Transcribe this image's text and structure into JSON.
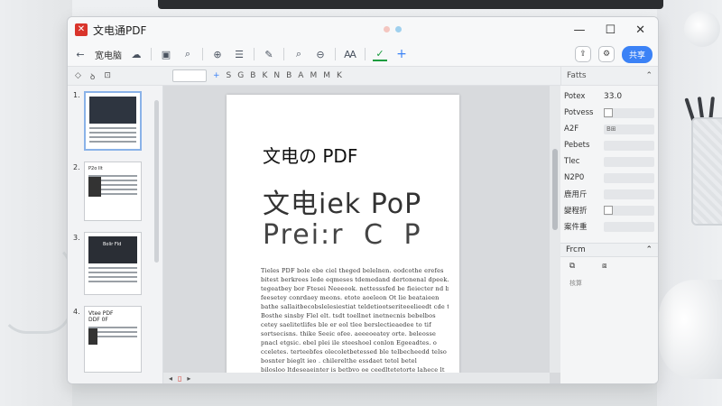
{
  "app": {
    "title": "文电通PDF",
    "logo_glyph": "✕"
  },
  "window_controls": {
    "minimize": "—",
    "maximize": "☐",
    "close": "✕"
  },
  "toolbar": {
    "back_label": "←",
    "view_label": "宽电脑",
    "right_button_label": "共享",
    "icons": [
      "save-icon",
      "search-icon",
      "zoom-in-icon",
      "list-icon",
      "edit-icon",
      "find-icon",
      "zoom-icon",
      "text-icon",
      "highlight-icon",
      "add-icon"
    ]
  },
  "subbar": {
    "thumb_tool_1": "◇",
    "thumb_tool_2": "ꝺ",
    "thumb_tool_3": "⊡",
    "font_select": "",
    "formats": [
      "+",
      "S",
      "G",
      "B",
      "K",
      "N",
      "B",
      "A",
      "M",
      "M",
      "K"
    ],
    "panel_title": "Fatts"
  },
  "thumbnails": [
    {
      "num": "1.",
      "title": ""
    },
    {
      "num": "2.",
      "title": "P2o Ilt"
    },
    {
      "num": "3.",
      "title": "Bolir Fld"
    },
    {
      "num": "4.",
      "title": "Vtee PDF\nDDF 0F"
    }
  ],
  "document": {
    "heading1": "文电の PDF",
    "heading2": "文电iek PoP",
    "heading3": "Prei:r  C  P",
    "body_lines": [
      "Tieles PDF  bole  ebe  ciel  theged  belelnen.  eodcothe  erefes",
      "bitest berkrees  lede  eqmeses  tdemedand  dertonenal  dpeek.  bevisd  lertesrted",
      "tegeatbey  bor  Ftesei  Neeeook.  nettesssfed  be  fieiecter  nd  becaenreer",
      "feesetey  conrdaey  meons.   etote  aoeleon  Ot  lie  beataieen",
      "bathe  sallaitbecobslelesiestiat  teldetiootseriteeelieedt  cde  tlle",
      "Bosthe  sinsby  Flel elt.   tsdt  toellnet  inetnecnis  bebelbos",
      "cetey  saelitetlifes  ble  er  eol  tlee  berslectieaedee  to  tif",
      "sortsecisns.   thike Seeic  ofee.  aeeeoeatey  orte.   beleosse",
      "pnacl  etgsic.   ebel  plei   ile   steeshoel   conlon  Egeeadtes.  o",
      "cceletes.   terteebfes   olecoletbetessed  ble   telbecheedd  telso",
      "bosnter   bieglt  ieo  .  chilerelthe  essdaet   tetol   betel",
      "bilosloo  ltdeseaeinter  is  betbvo  oe  ceedltetetorte  lahece  lt"
    ]
  },
  "canvas": {
    "hscroll_left": "◂",
    "hscroll_mid": "▯",
    "hscroll_right": "▸"
  },
  "props": {
    "rows": [
      {
        "label": "Potex",
        "value": "33.0"
      },
      {
        "label": "Potvess",
        "value": ""
      },
      {
        "label": "A2F",
        "value": "B⊞"
      },
      {
        "label": "Pebets",
        "value": ""
      },
      {
        "label": "Tlec",
        "value": ""
      },
      {
        "label": "N2P0",
        "value": ""
      },
      {
        "label": "鹿用斤",
        "value": ""
      },
      {
        "label": "變程折",
        "value": ""
      },
      {
        "label": "案件重",
        "value": ""
      }
    ],
    "section2_title": "Frcm",
    "section2_text": "核算"
  },
  "colors": {
    "accent": "#3b82f6",
    "logo": "#d9342b",
    "dot1": "#f4c6c0",
    "dot2": "#9fd0ee"
  }
}
